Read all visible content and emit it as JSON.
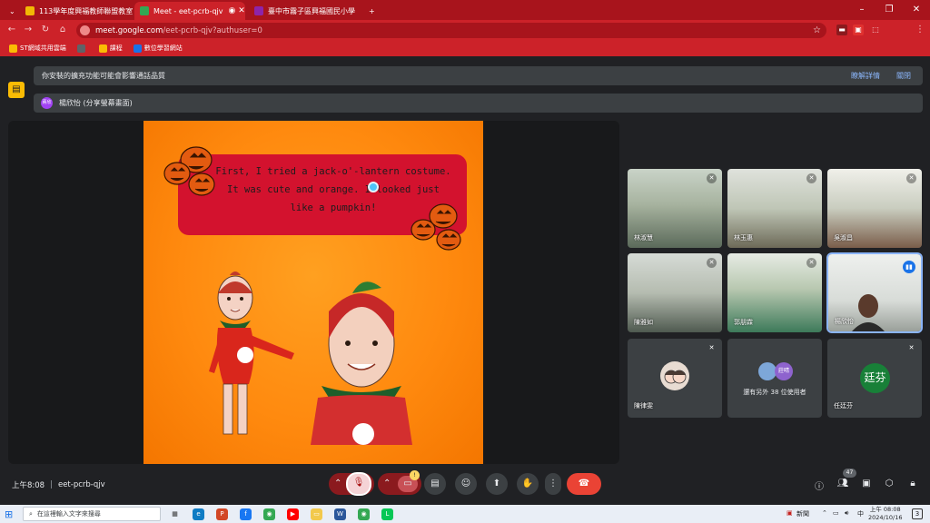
{
  "browser": {
    "tabs": [
      {
        "title": "113學年度興福教師聯盟教室",
        "color": "#f2b705",
        "active": false
      },
      {
        "title": "Meet - eet-pcrb-qjv",
        "color": "#34a853",
        "active": true
      },
      {
        "title": "臺中市霧子區興福國民小學",
        "color": "#8e24aa",
        "active": false
      }
    ],
    "new_tab": "+",
    "url_host": "meet.google.com",
    "url_path": "/eet-pcrb-qjv?authuser=0",
    "bookmarks": [
      {
        "label": "ST網域共用雲端",
        "color": "#fbbc04"
      },
      {
        "label": "",
        "color": "#5f6368"
      },
      {
        "label": "課程",
        "color": "#fbbc04"
      },
      {
        "label": "數位學習網站",
        "color": "#1a73e8"
      }
    ],
    "profile_initials": "GS"
  },
  "meet": {
    "notice_text": "你安裝的擴充功能可能會影響通話品質",
    "notice_details": "瞭解詳情",
    "notice_close": "關閉",
    "presenter_avatar": "蔣欣",
    "presenter_text": "楊欣怡 (分享螢幕畫面)",
    "slide_caption": "First, I tried a jack-o'-lantern costume. It was cute and orange. I looked just like a pumpkin!",
    "participants": [
      {
        "name": "林淑慧"
      },
      {
        "name": "林玉惠"
      },
      {
        "name": "吳淑昌"
      },
      {
        "name": "陳雅如"
      },
      {
        "name": "郭朋霖"
      },
      {
        "name": "楊欣怡"
      },
      {
        "name": "陳律雯"
      },
      {
        "name": "",
        "others_text": "還有另外 38 位使用者",
        "avatar2": "莊晴"
      },
      {
        "name": "任廷芬",
        "avatar_letter": "廷芬"
      }
    ],
    "time": "上午8:08",
    "meeting_code": "eet-pcrb-qjv",
    "participant_count": "47",
    "camera_badge": "!"
  },
  "taskbar": {
    "search_placeholder": "在這裡輸入文字來搜尋",
    "weather_label": "新聞",
    "ime": "中",
    "clock_time": "上午 08:08",
    "clock_date": "2024/10/16",
    "notif_count": "3"
  },
  "colors": {
    "chrome_red": "#cc2229",
    "meet_bg": "#202124",
    "end_call": "#ea4335",
    "slide_orange": "#ff8a0f",
    "caption_red": "#d3122e"
  }
}
